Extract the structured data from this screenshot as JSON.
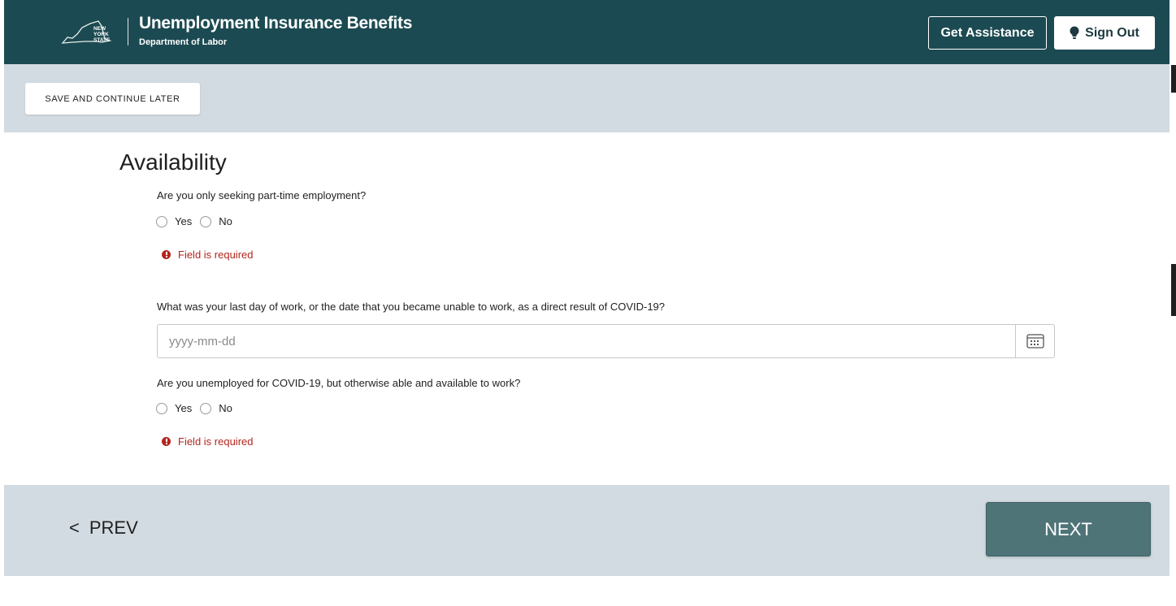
{
  "header": {
    "logo_text": [
      "NEW",
      "YORK",
      "STATE"
    ],
    "title": "Unemployment Insurance Benefits",
    "subtitle": "Department of Labor",
    "assist_label": "Get Assistance",
    "signout_label": "Sign Out"
  },
  "toolbar": {
    "save_label": "SAVE AND CONTINUE LATER"
  },
  "main": {
    "title": "Availability",
    "q1": {
      "question": "Are you only seeking part-time employment?",
      "yes_label": "Yes",
      "no_label": "No",
      "error": "Field is required"
    },
    "q2": {
      "question": "What was your last day of work, or the date that you became unable to work, as a direct result of COVID-19?",
      "placeholder": "yyyy-mm-dd",
      "value": ""
    },
    "q3": {
      "question": "Are you unemployed for COVID-19, but otherwise able and available to work?",
      "yes_label": "Yes",
      "no_label": "No",
      "error": "Field is required"
    }
  },
  "footer": {
    "prev_symbol": "<",
    "prev_label": "PREV",
    "next_label": "NEXT"
  },
  "colors": {
    "header_bg": "#1c4a52",
    "bar_bg": "#d2dbe1",
    "error": "#b3261e",
    "next_bg": "#4f7478"
  },
  "icons": [
    "nys-logo-icon",
    "lightbulb-icon",
    "alert-circle-icon",
    "calendar-icon"
  ]
}
